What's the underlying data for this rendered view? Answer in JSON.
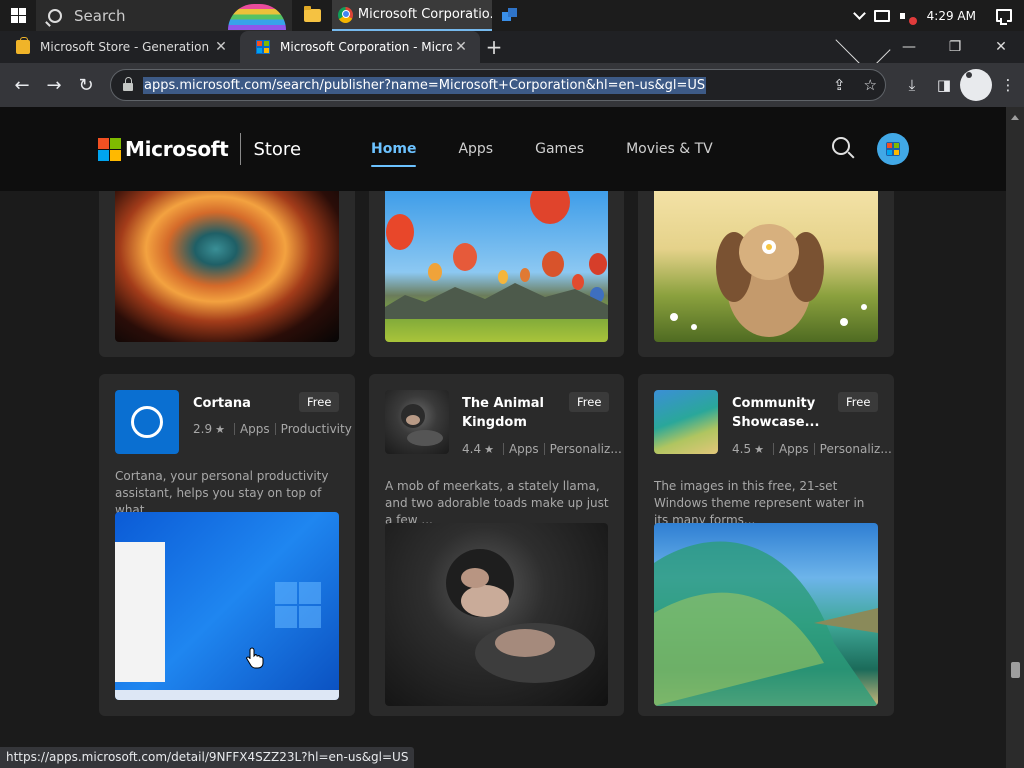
{
  "taskbar": {
    "search_placeholder": "Search",
    "active_window_title": "Microsoft Corporatio...",
    "time": "4:29 AM"
  },
  "browser": {
    "tabs": [
      {
        "title": "Microsoft Store - Generation Pro",
        "active": false
      },
      {
        "title": "Microsoft Corporation - Microsoft",
        "active": true
      }
    ],
    "url": "apps.microsoft.com/search/publisher?name=Microsoft+Corporation&hl=en-us&gl=US",
    "status_url": "https://apps.microsoft.com/detail/9NFFX4SZZ23L?hl=en-us&gl=US"
  },
  "store": {
    "brand": "Microsoft",
    "store_label": "Store",
    "nav": [
      {
        "label": "Home",
        "active": true
      },
      {
        "label": "Apps",
        "active": false
      },
      {
        "label": "Games",
        "active": false
      },
      {
        "label": "Movies & TV",
        "active": false
      }
    ]
  },
  "cards": [
    {
      "title": "Cortana",
      "badge": "Free",
      "rating": "2.9",
      "type": "Apps",
      "category": "Productivity",
      "description": "Cortana, your personal productivity assistant, helps you stay on top of what..."
    },
    {
      "title": "The Animal Kingdom",
      "badge": "Free",
      "rating": "4.4",
      "type": "Apps",
      "category": "Personaliz...",
      "description": "A mob of meerkats, a stately llama, and two adorable toads make up just a few ..."
    },
    {
      "title": "Community Showcase...",
      "badge": "Free",
      "rating": "4.5",
      "type": "Apps",
      "category": "Personaliz...",
      "description": "The images in this free, 21-set Windows theme represent water in its many forms..."
    }
  ],
  "colors": {
    "accent": "#6cc2ff",
    "header_bg": "#0e0e0e",
    "card_bg": "#2a2a2a"
  }
}
